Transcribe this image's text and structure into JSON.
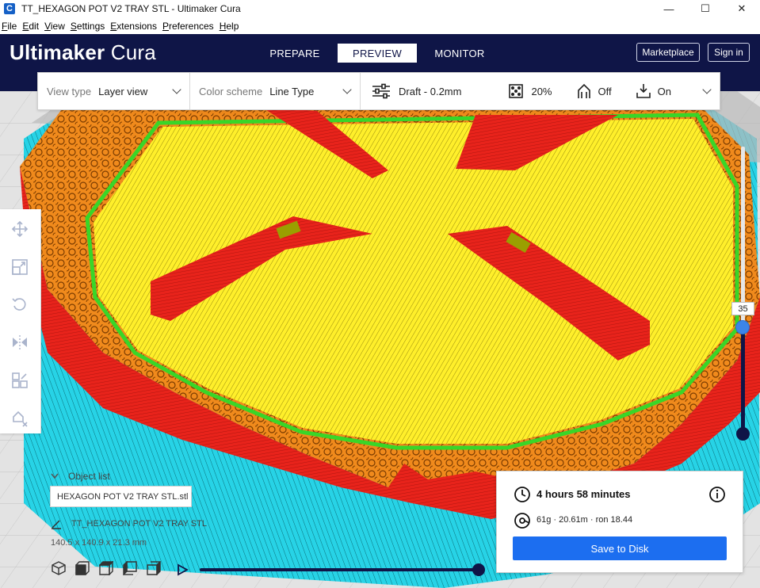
{
  "window": {
    "title": "TT_HEXAGON POT V2 TRAY STL - Ultimaker Cura",
    "app_icon": "C",
    "controls": [
      "—",
      "☐",
      "✕"
    ]
  },
  "menu": [
    {
      "label": "File",
      "accel": "F",
      "rest": "ile"
    },
    {
      "label": "Edit",
      "accel": "E",
      "rest": "dit"
    },
    {
      "label": "View",
      "accel": "V",
      "rest": "iew"
    },
    {
      "label": "Settings",
      "accel": "S",
      "rest": "ettings"
    },
    {
      "label": "Extensions",
      "accel": "E",
      "rest": "xtensions"
    },
    {
      "label": "Preferences",
      "accel": "P",
      "rest": "references"
    },
    {
      "label": "Help",
      "accel": "H",
      "rest": "elp"
    }
  ],
  "header": {
    "logo_bold": "Ultimaker",
    "logo_light": "Cura",
    "stages": [
      {
        "label": "PREPARE",
        "active": false
      },
      {
        "label": "PREVIEW",
        "active": true
      },
      {
        "label": "MONITOR",
        "active": false
      }
    ],
    "marketplace_label": "Marketplace",
    "signin_label": "Sign in"
  },
  "settings_bar": {
    "view_type_label": "View type",
    "view_type_value": "Layer view",
    "color_scheme_label": "Color scheme",
    "color_scheme_value": "Line Type",
    "profile": "Draft - 0.2mm",
    "infill": "20%",
    "support": "Off",
    "adhesion": "On"
  },
  "layer_slider": {
    "current_layer": "35"
  },
  "playback": {
    "progress": 1.0
  },
  "object_list": {
    "toggle_label": "Object list",
    "file_name": "HEXAGON POT V2 TRAY STL.stl",
    "object_name": "TT_HEXAGON POT V2 TRAY STL",
    "dimensions": "140.5 x 140.9 x 21.3 mm"
  },
  "print_info": {
    "time": "4 hours 58 minutes",
    "material": "61g · 20.61m · ron 18.44",
    "save_label": "Save to Disk"
  },
  "colors": {
    "header_bg": "#0f1547",
    "accent": "#1c6ef0",
    "slider_handle": "#3c85e8",
    "wall_red": "#e8231b",
    "infill_orange": "#f08a1c",
    "skin_yellow": "#ffef2a",
    "support_green": "#39d628",
    "skirt_cyan": "#27d3e6"
  }
}
